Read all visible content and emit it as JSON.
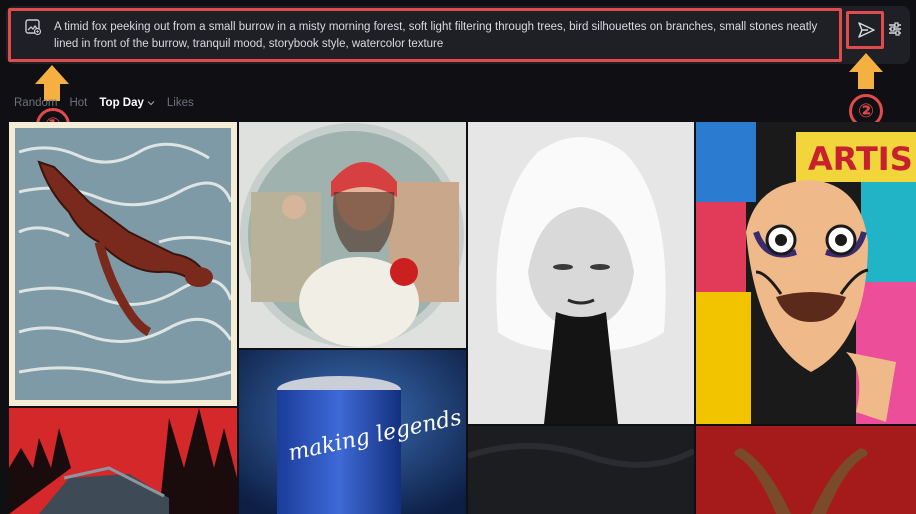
{
  "prompt": {
    "text": "A timid fox peeking out from a small burrow in a misty morning forest, soft light filtering through trees, bird silhouettes on branches, small stones neatly lined in front of the burrow, tranquil mood, storybook style, watercolor texture"
  },
  "annotations": {
    "marker_1": "①",
    "marker_2": "②"
  },
  "filters": [
    {
      "label": "Random",
      "active": false
    },
    {
      "label": "Hot",
      "active": false
    },
    {
      "label": "Top Day",
      "active": true
    },
    {
      "label": "Likes",
      "active": false
    }
  ],
  "gallery": {
    "tiles": [
      {
        "name": "dog-swimming-illustration"
      },
      {
        "name": "fisheye-selfie-store"
      },
      {
        "name": "hooded-woman-portrait"
      },
      {
        "name": "pop-art-collage-portrait",
        "caption": "ARTIS"
      },
      {
        "name": "red-cabin-forest"
      },
      {
        "name": "blue-can-ad",
        "caption": "making legends"
      },
      {
        "name": "dark-texture"
      },
      {
        "name": "red-background-object"
      }
    ]
  },
  "colors": {
    "highlight": "#e24b4b",
    "arrow": "#f5b041",
    "background": "#101014"
  }
}
